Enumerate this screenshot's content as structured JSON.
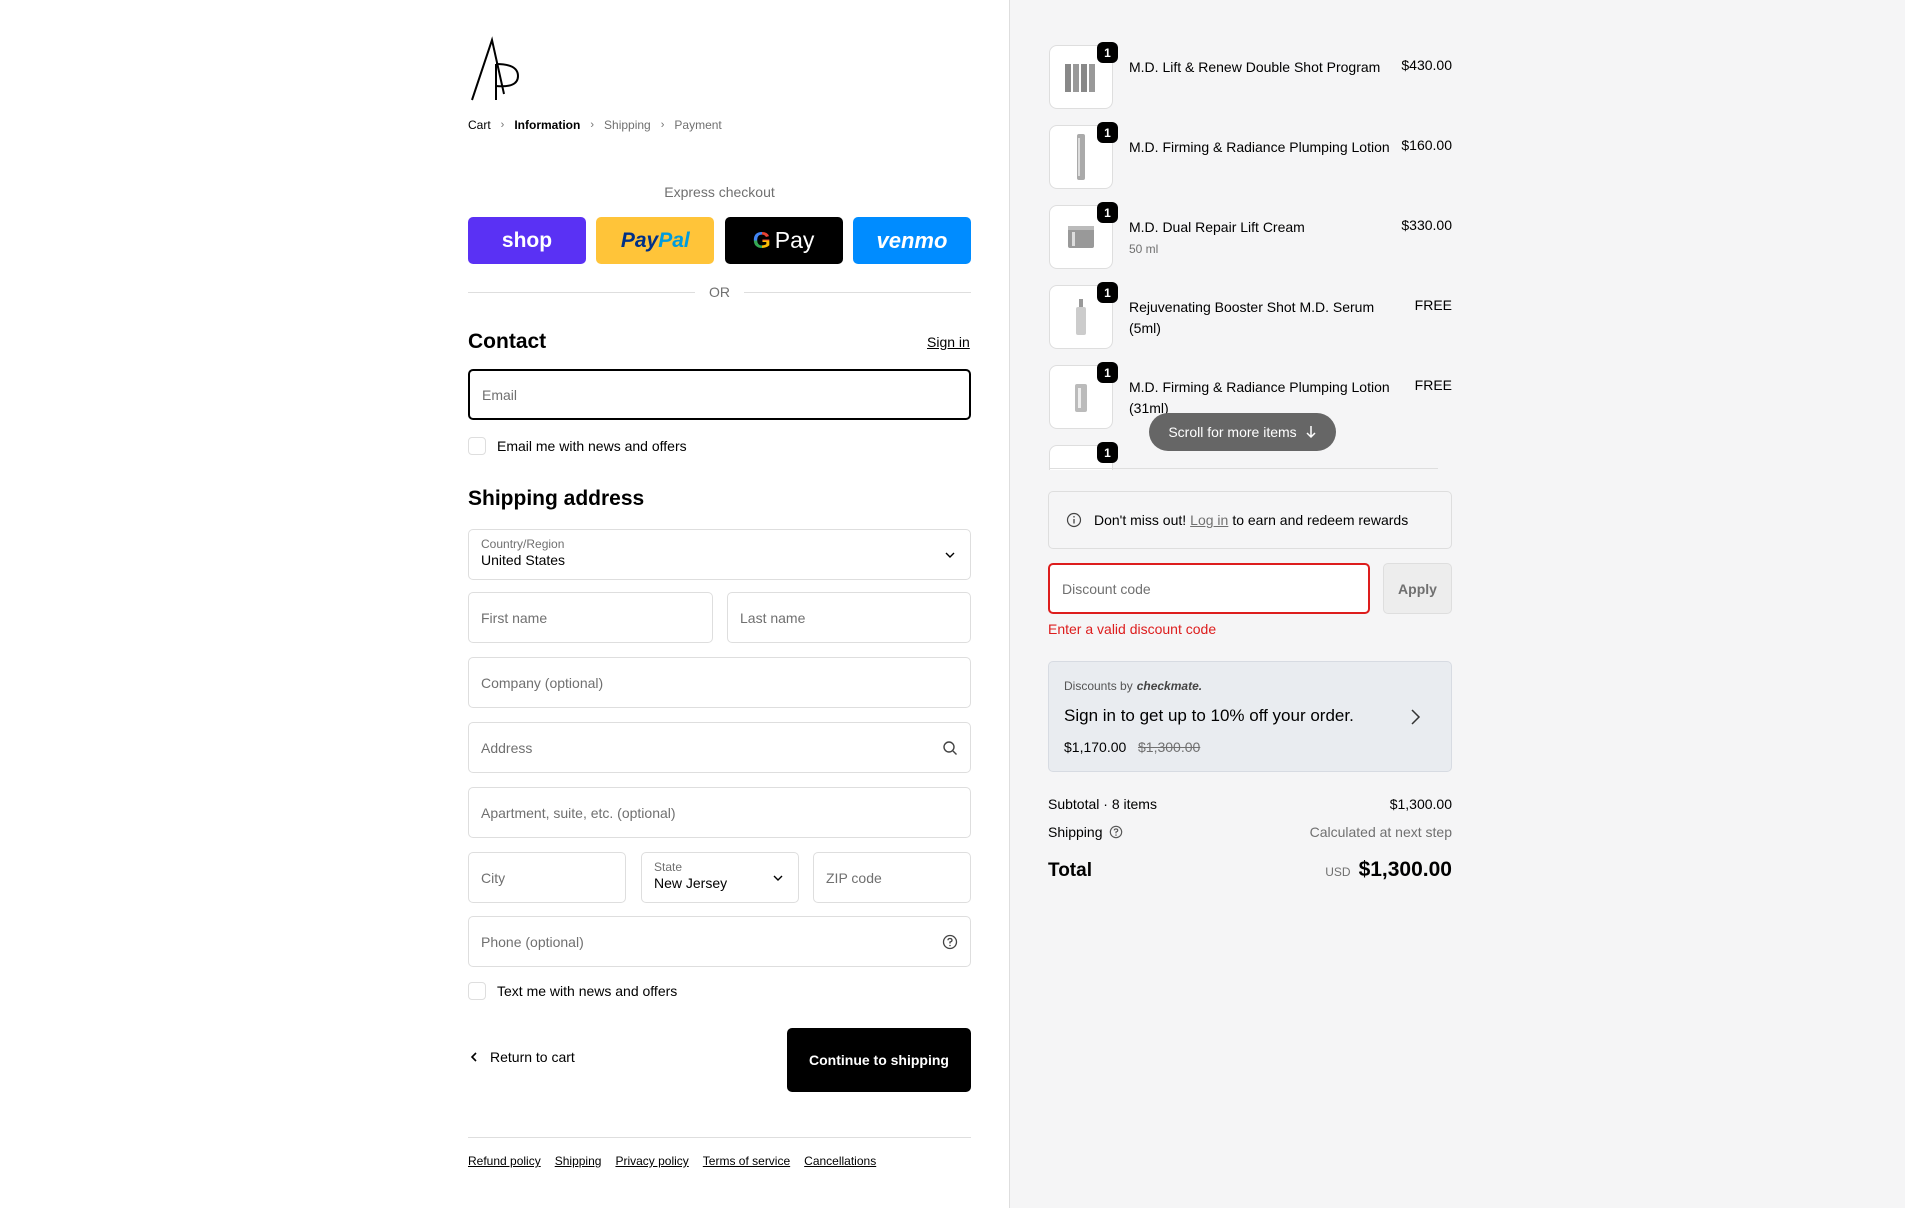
{
  "breadcrumbs": {
    "cart": "Cart",
    "information": "Information",
    "shipping": "Shipping",
    "payment": "Payment"
  },
  "express": {
    "title": "Express checkout",
    "shop": "shop",
    "paypal_a": "Pay",
    "paypal_b": "Pal",
    "gpay_g": "G",
    "gpay_text": "Pay",
    "venmo": "venmo",
    "or": "OR"
  },
  "contact": {
    "heading": "Contact",
    "sign_in": "Sign in",
    "email_placeholder": "Email",
    "email_news": "Email me with news and offers"
  },
  "shipping_address": {
    "heading": "Shipping address",
    "country_label": "Country/Region",
    "country_value": "United States",
    "first_name": "First name",
    "last_name": "Last name",
    "company": "Company (optional)",
    "address": "Address",
    "apartment": "Apartment, suite, etc. (optional)",
    "city": "City",
    "state_label": "State",
    "state_value": "New Jersey",
    "zip": "ZIP code",
    "phone": "Phone (optional)",
    "text_news": "Text me with news and offers"
  },
  "actions": {
    "return": "Return to cart",
    "continue": "Continue to shipping"
  },
  "footer": [
    "Refund policy",
    "Shipping",
    "Privacy policy",
    "Terms of service",
    "Cancellations"
  ],
  "order": {
    "items": [
      {
        "qty": "1",
        "name": "M.D. Lift & Renew Double Shot Program",
        "sub": "",
        "price": "$430.00"
      },
      {
        "qty": "1",
        "name": "M.D. Firming & Radiance Plumping Lotion",
        "sub": "",
        "price": "$160.00"
      },
      {
        "qty": "1",
        "name": "M.D. Dual Repair Lift Cream",
        "sub": "50 ml",
        "price": "$330.00"
      },
      {
        "qty": "1",
        "name": "Rejuvenating Booster Shot M.D. Serum (5ml)",
        "sub": "",
        "price": "FREE"
      },
      {
        "qty": "1",
        "name": "M.D. Firming & Radiance Plumping Lotion (31ml)",
        "sub": "",
        "price": "FREE"
      },
      {
        "qty": "1",
        "name": "",
        "sub": "",
        "price": ""
      }
    ],
    "scroll_hint": "Scroll for more items",
    "rewards_a": "Don't miss out!",
    "rewards_login": "Log in",
    "rewards_b": "to earn and redeem rewards",
    "discount_placeholder": "Discount code",
    "apply": "Apply",
    "discount_error": "Enter a valid discount code",
    "checkmate_by": "Discounts by",
    "checkmate_brand": "checkmate.",
    "checkmate_title": "Sign in to get up to 10% off your order.",
    "checkmate_new": "$1,170.00",
    "checkmate_old": "$1,300.00",
    "subtotal_label": "Subtotal · 8 items",
    "subtotal_value": "$1,300.00",
    "shipping_label": "Shipping",
    "shipping_value": "Calculated at next step",
    "total_label": "Total",
    "total_currency": "USD",
    "total_value": "$1,300.00"
  }
}
